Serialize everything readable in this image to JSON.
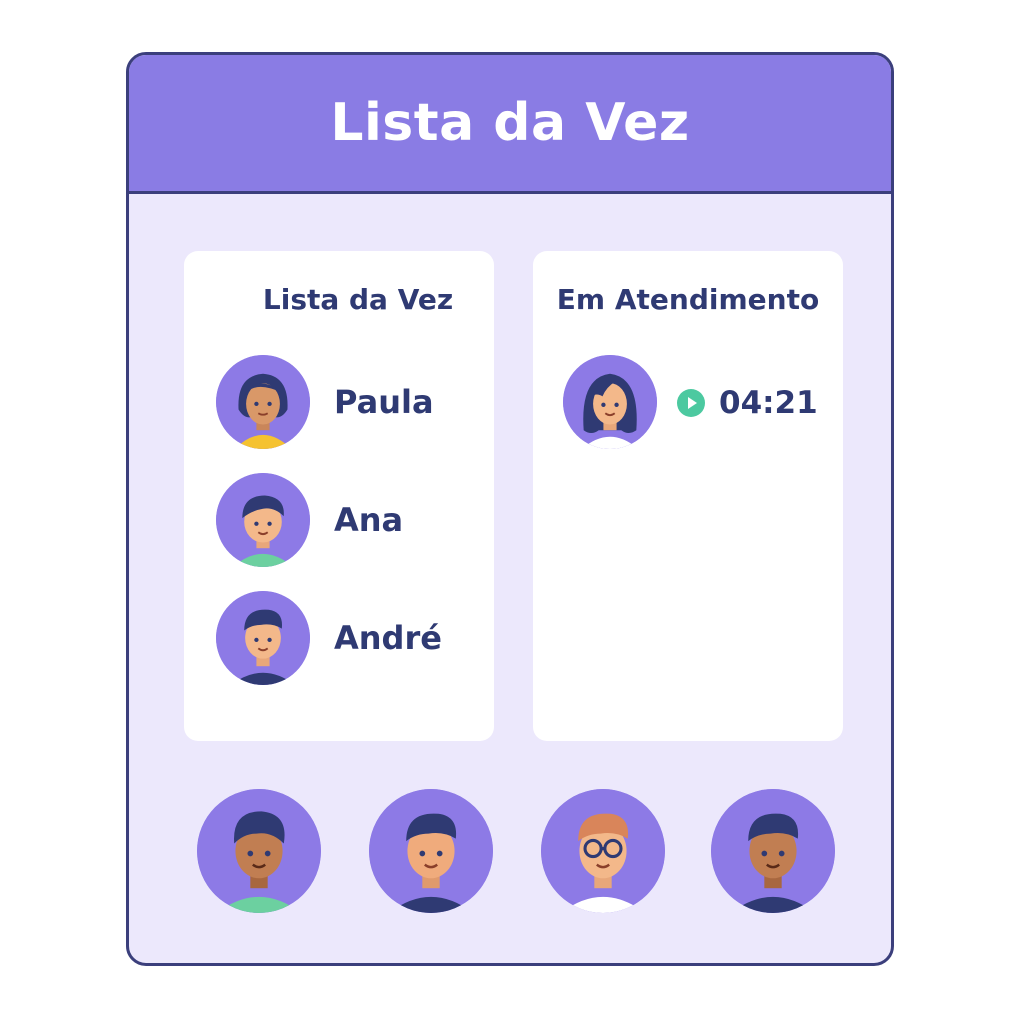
{
  "header": {
    "title": "Lista da Vez"
  },
  "queue_panel": {
    "title": "Lista da Vez",
    "items": [
      {
        "name": "Paula",
        "avatar": "woman-avatar-icon"
      },
      {
        "name": "Ana",
        "avatar": "boy-avatar-icon"
      },
      {
        "name": "André",
        "avatar": "man-avatar-icon"
      }
    ]
  },
  "active_panel": {
    "title": "Em Atendimento",
    "avatar": "woman-long-hair-avatar-icon",
    "timer_icon": "play-icon",
    "timer": "04:21"
  },
  "bottom_avatars": [
    {
      "avatar": "man-avatar-icon"
    },
    {
      "avatar": "man-avatar-icon"
    },
    {
      "avatar": "man-glasses-avatar-icon"
    },
    {
      "avatar": "man-avatar-icon"
    }
  ],
  "colors": {
    "header": "#8a7ce4",
    "background": "#ece8fc",
    "card": "#ffffff",
    "text": "#2f3a73",
    "avatar_circle": "#8d7ae6",
    "timer_accent": "#4cc9a0"
  }
}
